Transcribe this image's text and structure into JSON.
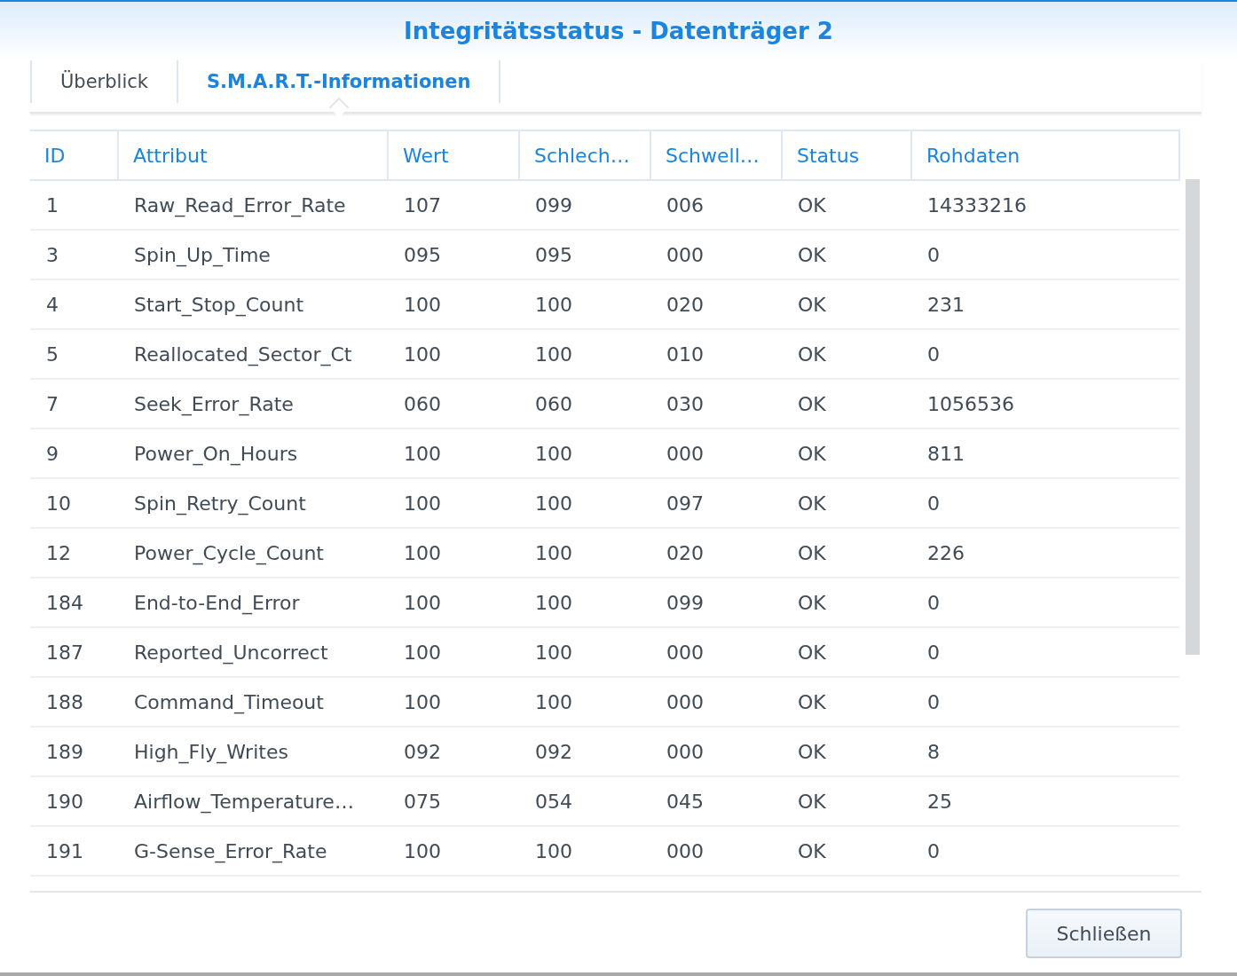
{
  "window": {
    "title": "Integritätsstatus - Datenträger 2"
  },
  "tabs": [
    {
      "label": "Überblick",
      "selected": false
    },
    {
      "label": "S.M.A.R.T.-Informationen",
      "selected": true
    }
  ],
  "table": {
    "columns": [
      "ID",
      "Attribut",
      "Wert",
      "Schlech…",
      "Schwell…",
      "Status",
      "Rohdaten"
    ],
    "rows": [
      [
        "1",
        "Raw_Read_Error_Rate",
        "107",
        "099",
        "006",
        "OK",
        "14333216"
      ],
      [
        "3",
        "Spin_Up_Time",
        "095",
        "095",
        "000",
        "OK",
        "0"
      ],
      [
        "4",
        "Start_Stop_Count",
        "100",
        "100",
        "020",
        "OK",
        "231"
      ],
      [
        "5",
        "Reallocated_Sector_Ct",
        "100",
        "100",
        "010",
        "OK",
        "0"
      ],
      [
        "7",
        "Seek_Error_Rate",
        "060",
        "060",
        "030",
        "OK",
        "1056536"
      ],
      [
        "9",
        "Power_On_Hours",
        "100",
        "100",
        "000",
        "OK",
        "811"
      ],
      [
        "10",
        "Spin_Retry_Count",
        "100",
        "100",
        "097",
        "OK",
        "0"
      ],
      [
        "12",
        "Power_Cycle_Count",
        "100",
        "100",
        "020",
        "OK",
        "226"
      ],
      [
        "184",
        "End-to-End_Error",
        "100",
        "100",
        "099",
        "OK",
        "0"
      ],
      [
        "187",
        "Reported_Uncorrect",
        "100",
        "100",
        "000",
        "OK",
        "0"
      ],
      [
        "188",
        "Command_Timeout",
        "100",
        "100",
        "000",
        "OK",
        "0"
      ],
      [
        "189",
        "High_Fly_Writes",
        "092",
        "092",
        "000",
        "OK",
        "8"
      ],
      [
        "190",
        "Airflow_Temperature…",
        "075",
        "054",
        "045",
        "OK",
        "25"
      ],
      [
        "191",
        "G-Sense_Error_Rate",
        "100",
        "100",
        "000",
        "OK",
        "0"
      ]
    ]
  },
  "buttons": [
    "Schließen"
  ]
}
